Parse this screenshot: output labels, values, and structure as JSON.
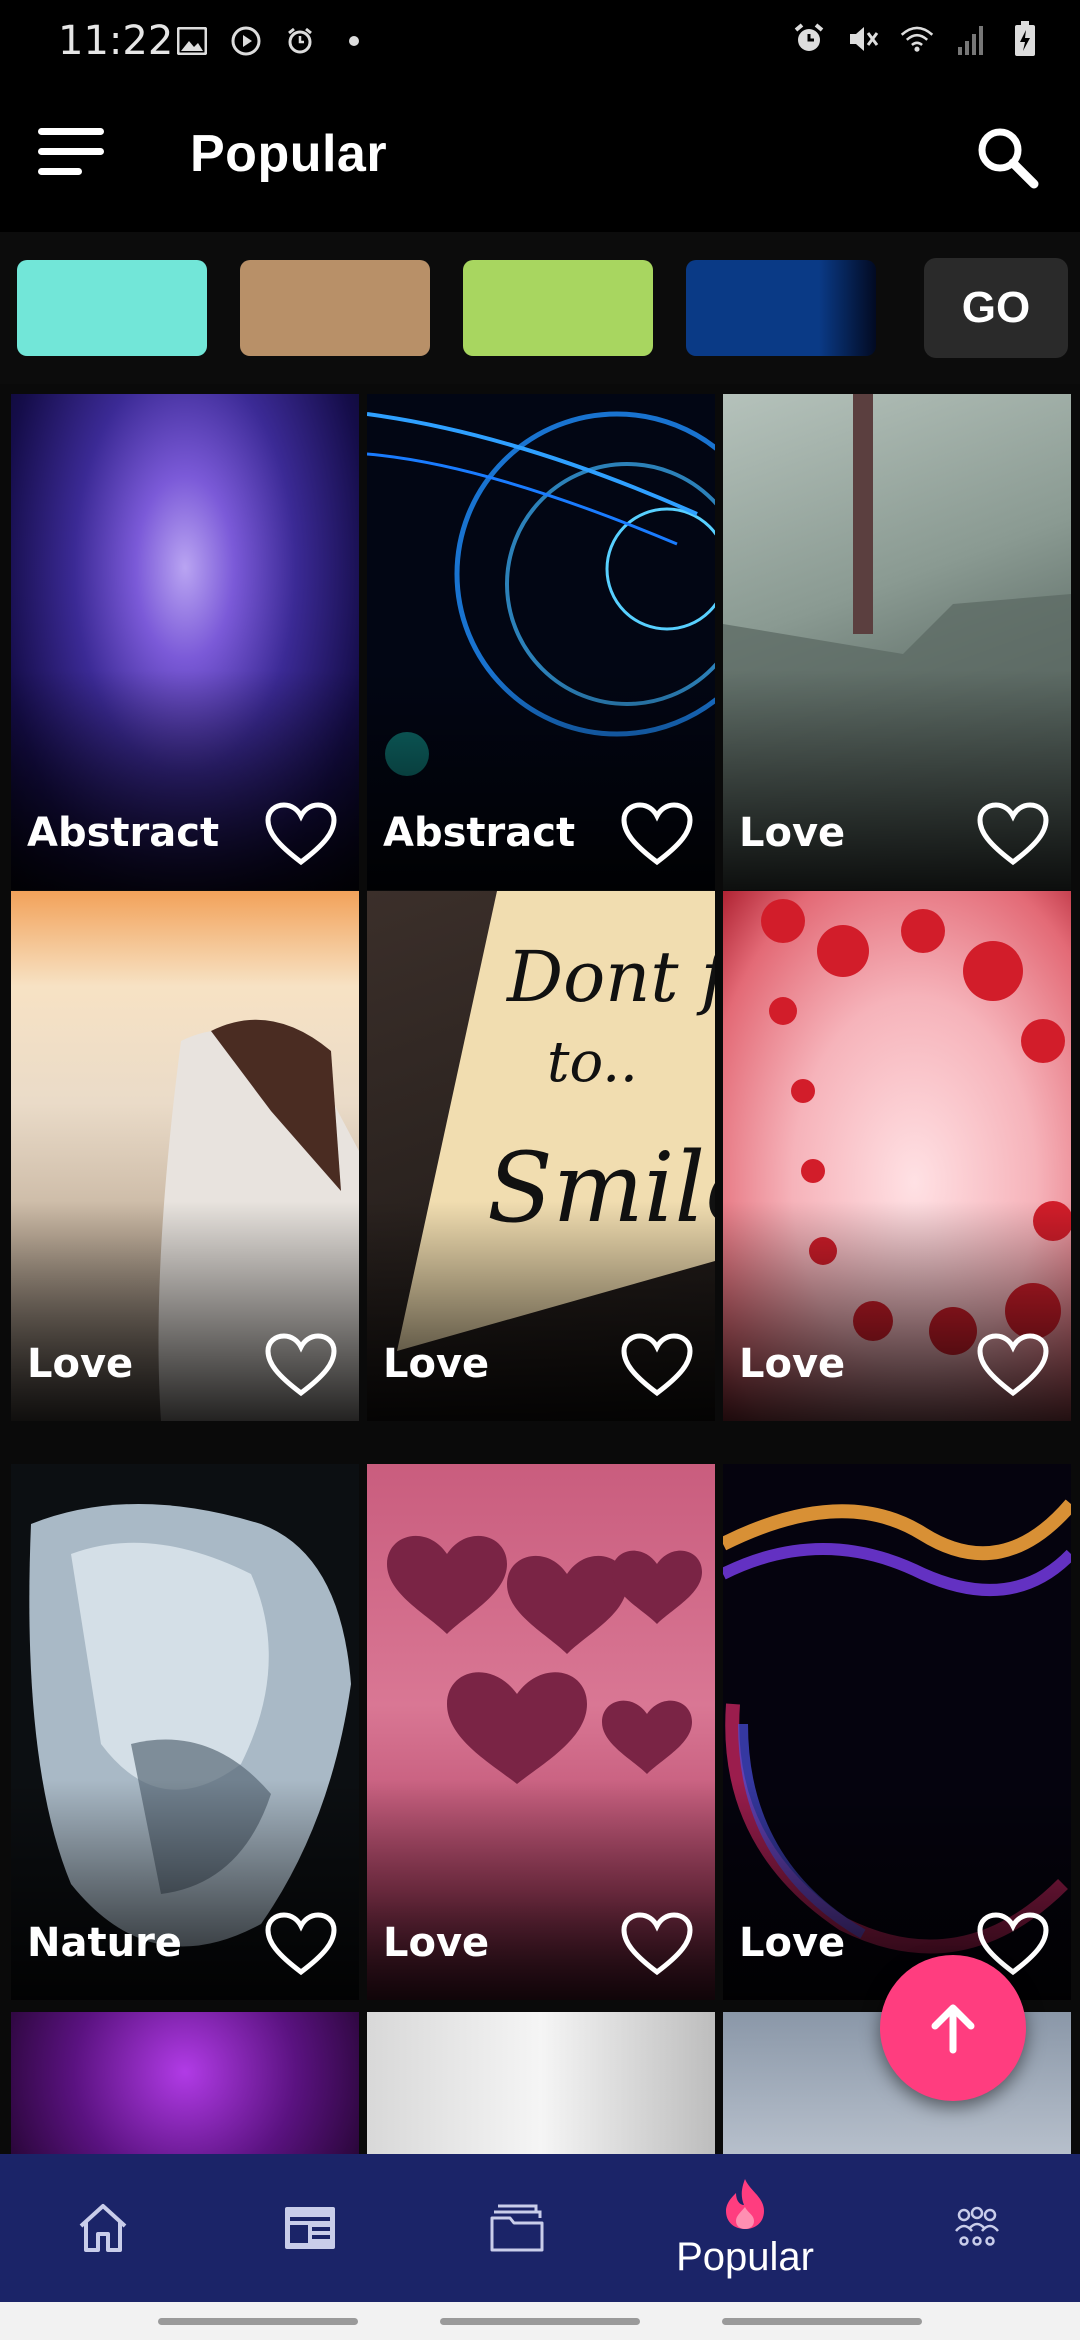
{
  "status_bar": {
    "time": "11:22",
    "left_icons": [
      "gallery-icon",
      "media-play-icon",
      "alarm-icon",
      "dot-icon"
    ],
    "right_icons": [
      "alarm-icon",
      "mute-icon",
      "wifi-icon",
      "signal-icon",
      "battery-icon"
    ]
  },
  "app_bar": {
    "title": "Popular",
    "menu_icon": "menu-icon",
    "search_icon": "search-icon"
  },
  "color_filters": {
    "colors": [
      "#72e6d8",
      "#b89068",
      "#a8d660",
      "#0a3a86"
    ],
    "go_label": "GO"
  },
  "wallpapers": [
    {
      "category": "Abstract",
      "favorited": false
    },
    {
      "category": "Abstract",
      "favorited": false
    },
    {
      "category": "Love",
      "favorited": false
    },
    {
      "category": "Love",
      "favorited": false
    },
    {
      "category": "Love",
      "favorited": false
    },
    {
      "category": "Love",
      "favorited": false
    },
    {
      "category": "Nature",
      "favorited": false
    },
    {
      "category": "Love",
      "favorited": false
    },
    {
      "category": "Love",
      "favorited": false
    }
  ],
  "bottom_nav": {
    "items": [
      {
        "icon": "home-icon",
        "label": ""
      },
      {
        "icon": "wallpaper-icon",
        "label": ""
      },
      {
        "icon": "folder-icon",
        "label": ""
      },
      {
        "icon": "fire-icon",
        "label": "Popular",
        "active": true
      },
      {
        "icon": "community-icon",
        "label": ""
      }
    ]
  },
  "fab_icon": "arrow-up-icon"
}
